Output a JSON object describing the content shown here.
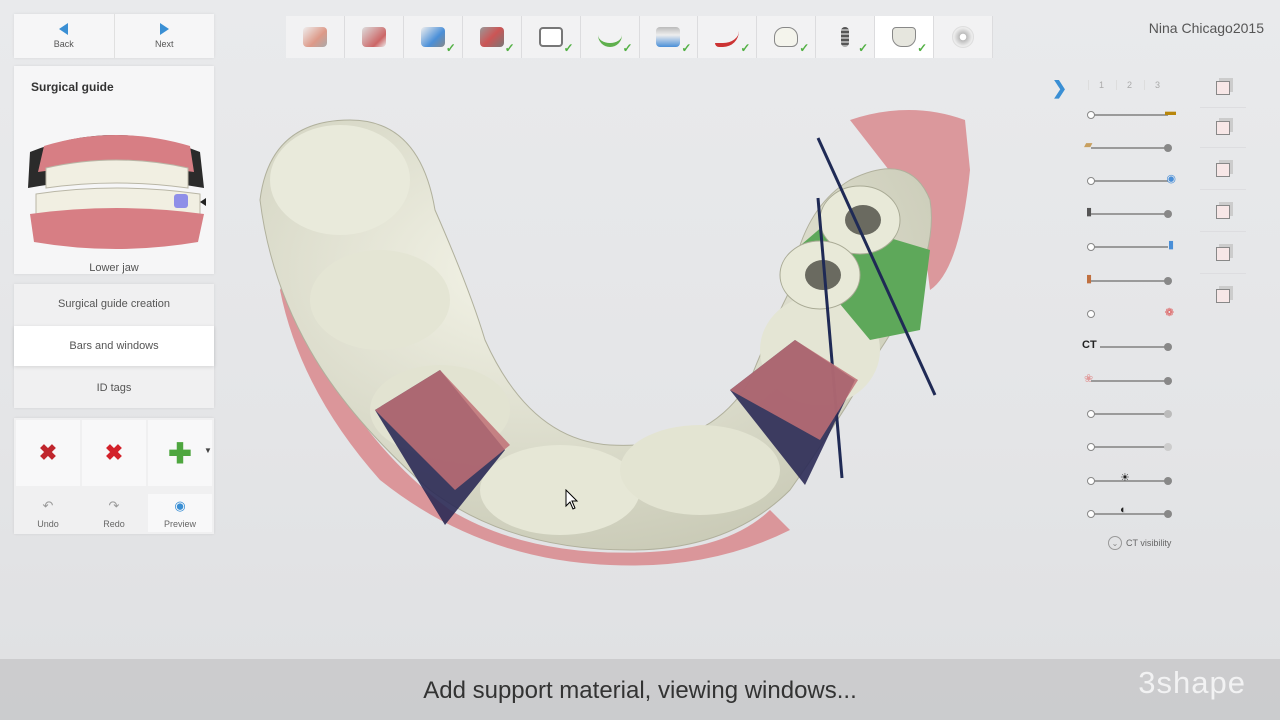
{
  "nav": {
    "back_label": "Back",
    "next_label": "Next"
  },
  "user": {
    "name": "Nina Chicago2015"
  },
  "workflow": {
    "steps": [
      {
        "icon": "order-form-icon",
        "done": false
      },
      {
        "icon": "patient-card-icon",
        "done": false
      },
      {
        "icon": "scan-import-icon",
        "done": true
      },
      {
        "icon": "implant-tools-icon",
        "done": true
      },
      {
        "icon": "ct-slice-icon",
        "done": true
      },
      {
        "icon": "arch-curve-icon",
        "done": true
      },
      {
        "icon": "implant-plan-icon",
        "done": true
      },
      {
        "icon": "sleeve-icon",
        "done": true
      },
      {
        "icon": "tooth-icon",
        "done": true
      },
      {
        "icon": "implant-screw-icon",
        "done": true
      },
      {
        "icon": "surgical-guide-icon",
        "done": true,
        "active": true
      },
      {
        "icon": "export-disc-icon",
        "done": false
      }
    ]
  },
  "sidebar": {
    "title": "Surgical guide",
    "jaw_label": "Lower jaw",
    "steps": [
      "Surgical guide creation",
      "Bars and windows",
      "ID tags"
    ],
    "active_step": 1,
    "actions": {
      "undo": "Undo",
      "redo": "Redo",
      "preview": "Preview"
    }
  },
  "right_panel": {
    "tabs": [
      "1",
      "2",
      "3"
    ],
    "ct_label": "CT",
    "ct_visibility": "CT visibility"
  },
  "caption": {
    "text": "Add support material, viewing windows...",
    "brand": "3shape"
  },
  "colors": {
    "accent": "#3a8fd4",
    "check": "#52b043",
    "guide": "#dedfcc",
    "gum": "#d88a8e"
  }
}
